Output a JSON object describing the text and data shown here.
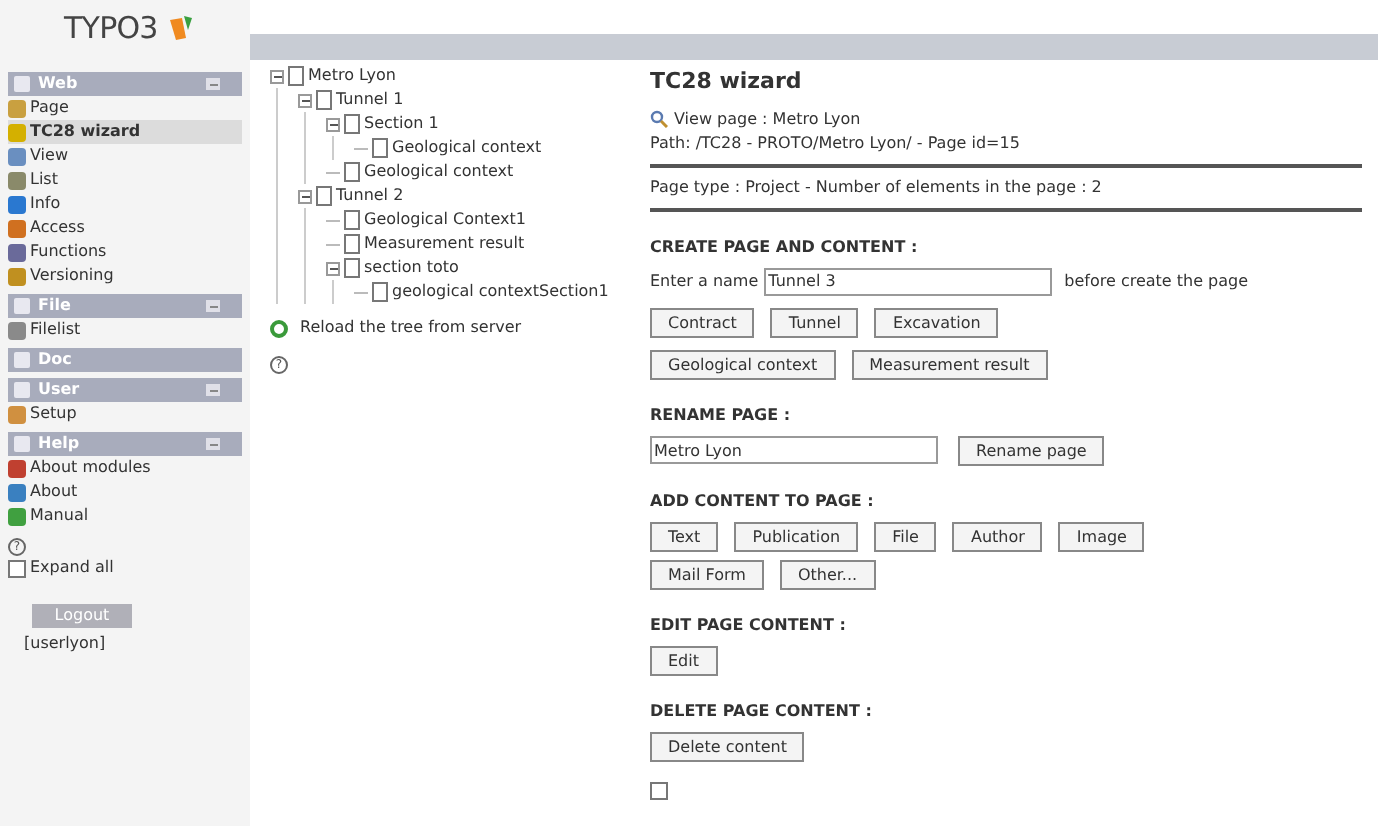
{
  "logo": {
    "text": "TYPO3"
  },
  "sidebar": {
    "groups": [
      {
        "title": "Web",
        "collapsible": true,
        "items": [
          {
            "label": "Page",
            "selected": false
          },
          {
            "label": "TC28 wizard",
            "selected": true
          },
          {
            "label": "View",
            "selected": false
          },
          {
            "label": "List",
            "selected": false
          },
          {
            "label": "Info",
            "selected": false
          },
          {
            "label": "Access",
            "selected": false
          },
          {
            "label": "Functions",
            "selected": false
          },
          {
            "label": "Versioning",
            "selected": false
          }
        ]
      },
      {
        "title": "File",
        "collapsible": true,
        "items": [
          {
            "label": "Filelist",
            "selected": false
          }
        ]
      },
      {
        "title": "Doc",
        "collapsible": false
      },
      {
        "title": "User",
        "collapsible": true,
        "items": [
          {
            "label": "Setup",
            "selected": false
          }
        ]
      },
      {
        "title": "Help",
        "collapsible": true,
        "items": [
          {
            "label": "About modules",
            "selected": false
          },
          {
            "label": "About",
            "selected": false
          },
          {
            "label": "Manual",
            "selected": false
          }
        ]
      }
    ],
    "help_icon": "?",
    "expand_all": {
      "label": "Expand all",
      "checked": false
    },
    "logout": "Logout",
    "user": "[userlyon]"
  },
  "tree": {
    "nodes": [
      {
        "label": "Metro Lyon",
        "expanded": true,
        "children": [
          {
            "label": "Tunnel 1",
            "expanded": true,
            "children": [
              {
                "label": "Section 1",
                "expanded": true,
                "children": [
                  {
                    "label": "Geological context"
                  }
                ]
              },
              {
                "label": "Geological context"
              }
            ]
          },
          {
            "label": "Tunnel 2",
            "expanded": true,
            "children": [
              {
                "label": "Geological Context1"
              },
              {
                "label": "Measurement result"
              },
              {
                "label": "section toto",
                "expanded": true,
                "children": [
                  {
                    "label": "geological contextSection1"
                  }
                ]
              }
            ]
          }
        ]
      }
    ],
    "reload": "Reload the tree from server",
    "help_icon": "?"
  },
  "main": {
    "title": "TC28 wizard",
    "view_page": "View page : Metro Lyon",
    "path": "Path: /TC28 - PROTO/Metro Lyon/ - Page id=15",
    "page_type": "Page type : Project - Number of elements in the page : 2",
    "create": {
      "heading": "CREATE PAGE AND CONTENT :",
      "prefix": "Enter a name",
      "value": "Tunnel 3",
      "suffix": "before create the page",
      "button_rows": [
        [
          "Contract",
          "Tunnel",
          "Excavation"
        ],
        [
          "Geological context",
          "Measurement result"
        ]
      ]
    },
    "rename": {
      "heading": "RENAME PAGE :",
      "value": "Metro Lyon",
      "button": "Rename page"
    },
    "add": {
      "heading": "ADD CONTENT TO PAGE :",
      "button_rows": [
        [
          "Text",
          "Publication",
          "File",
          "Author",
          "Image"
        ],
        [
          "Mail Form",
          "Other..."
        ]
      ]
    },
    "edit": {
      "heading": "EDIT PAGE CONTENT :",
      "button": "Edit"
    },
    "delete": {
      "heading": "DELETE PAGE CONTENT :",
      "button": "Delete content"
    }
  }
}
